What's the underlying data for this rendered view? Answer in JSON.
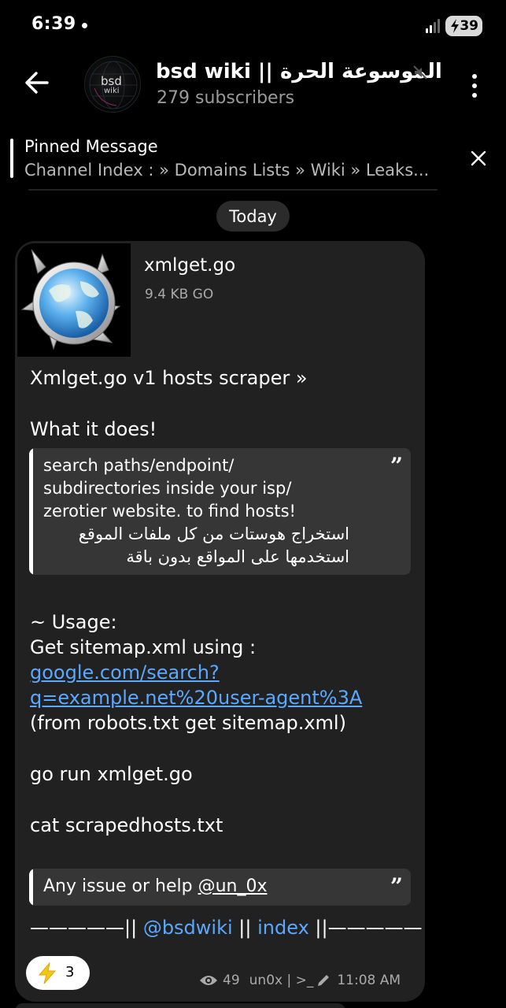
{
  "status_bar": {
    "time": "6:39",
    "battery": "39"
  },
  "header": {
    "title": "bsd wiki || الموسوعة الحرة",
    "subscribers": "279 subscribers",
    "avatar_line1": "bsd",
    "avatar_line2": "wiki"
  },
  "pinned": {
    "title": "Pinned Message",
    "text": "Channel Index :  » Domains Lists » Wiki » Leaks..."
  },
  "date_chip": "Today",
  "message": {
    "file": {
      "name": "xmlget.go",
      "size": "9.4 KB GO"
    },
    "line1": "Xmlget.go v1 hosts scraper »",
    "line2": "What it does!",
    "quote1": [
      "search paths/endpoint/",
      "subdirectories inside your isp/",
      "zerotier website. to find hosts!",
      "استخراج هوستات من كل ملفات الموقع",
      "استخدمها على المواقع بدون باقة"
    ],
    "usage_heading": "~ Usage:",
    "usage_line": "Get sitemap.xml using :",
    "link_line1": "google.com/search?",
    "link_line2": "q=example.net%20user-agent%3A",
    "robots_line": "(from robots.txt get sitemap.xml)",
    "cmd1": "go run xmlget.go",
    "cmd2": "cat scrapedhosts.txt",
    "quote2_prefix": "Any issue or help ",
    "quote2_handle": "@un_0x",
    "footer_left": "—————||",
    "footer_handle": "@bsdwiki",
    "footer_mid": "||",
    "footer_index": "index",
    "footer_right": "||—————",
    "reaction_count": "3",
    "views": "49",
    "author": "un0x | >_",
    "time": "11:08 AM"
  },
  "colors": {
    "link": "#5aa8ff",
    "bubble": "#212121",
    "quote_bg": "#363636"
  }
}
